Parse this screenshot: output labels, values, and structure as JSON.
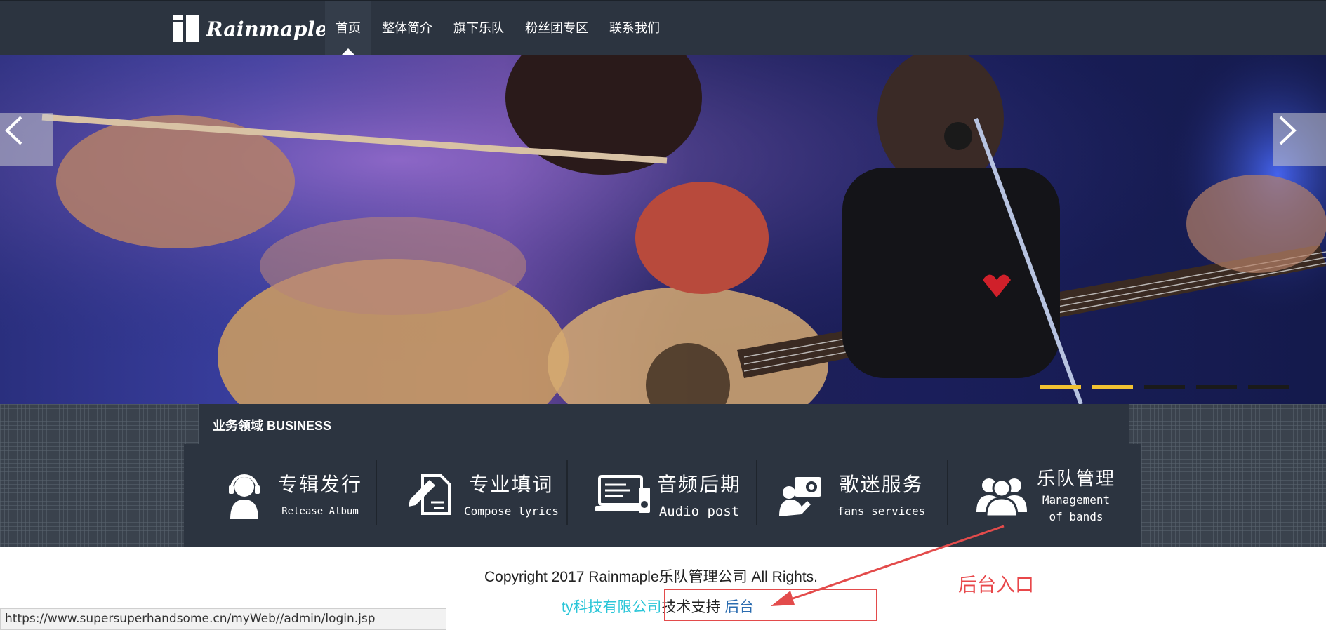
{
  "brand": {
    "name": "Rainmaple"
  },
  "nav": {
    "items": [
      {
        "label": "首页",
        "active": true
      },
      {
        "label": "整体简介"
      },
      {
        "label": "旗下乐队"
      },
      {
        "label": "粉丝团专区"
      },
      {
        "label": "联系我们"
      }
    ]
  },
  "hero": {
    "prev_icon": "chevron-left-icon",
    "next_icon": "chevron-right-icon",
    "slide_count": 5,
    "active_slides": [
      1,
      2
    ]
  },
  "business": {
    "title": "业务领域 BUSINESS",
    "items": [
      {
        "icon": "headset-user-icon",
        "cn": "专辑发行",
        "en": "Release Album"
      },
      {
        "icon": "pen-document-icon",
        "cn": "专业填词",
        "en": "Compose lyrics"
      },
      {
        "icon": "computer-audio-icon",
        "cn": "音频后期",
        "en": "Audio post"
      },
      {
        "icon": "fan-service-icon",
        "cn": "歌迷服务",
        "en": "fans services"
      },
      {
        "icon": "band-group-icon",
        "cn": "乐队管理",
        "en": "Management of bands",
        "en_line1": "Management",
        "en_line2": "of bands"
      }
    ]
  },
  "footer": {
    "copyright": "Copyright 2017 Rainmaple乐队管理公司 All Rights.",
    "company": "ty科技有限公司",
    "support": "技术支持",
    "backend_link": "后台"
  },
  "annotation": {
    "text": "后台入口",
    "color": "#e8474a"
  },
  "status_bar": {
    "url": "https://www.supersuperhandsome.cn/myWeb//admin/login.jsp"
  },
  "colors": {
    "navbar": "#2c3440",
    "dot_active": "#f1c232",
    "company_link": "#2bc6d8",
    "backend_link": "#2b6cb0"
  }
}
